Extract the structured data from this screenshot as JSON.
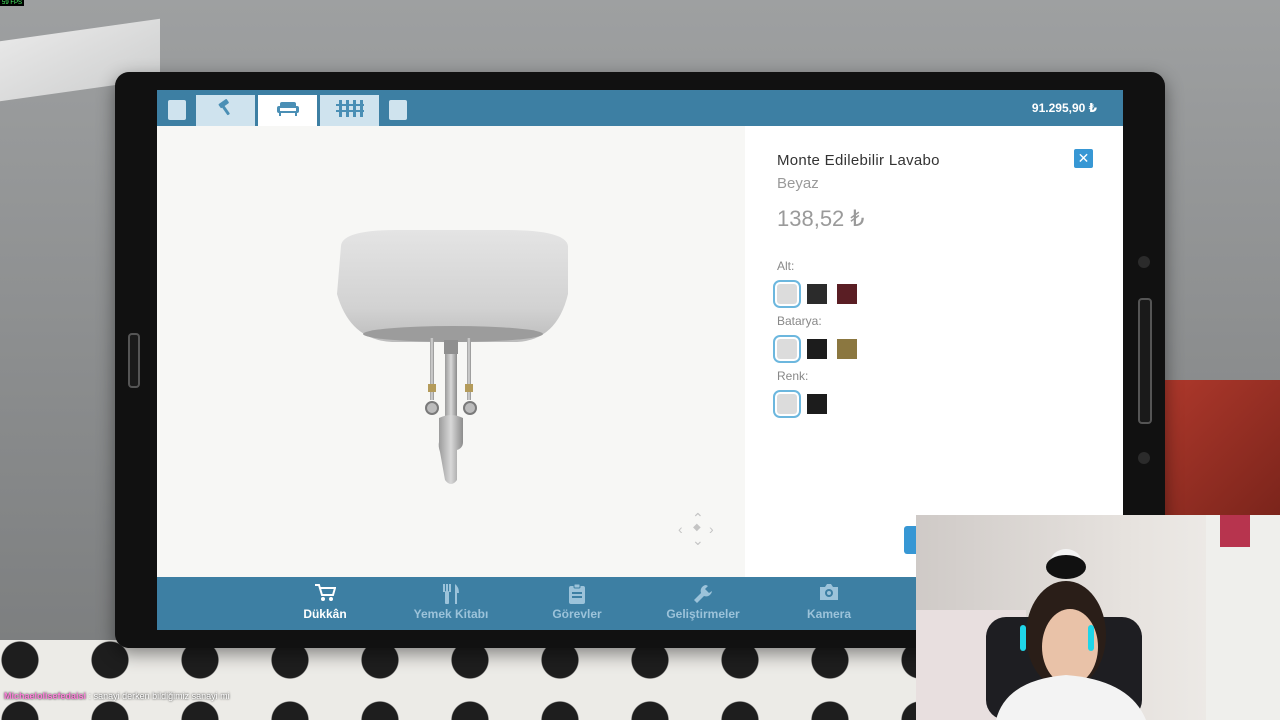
{
  "hud": {
    "fps": "59 FPS"
  },
  "topbar": {
    "tabs": [
      {
        "icon": "hammer-icon",
        "active": false
      },
      {
        "icon": "sofa-icon",
        "active": true
      },
      {
        "icon": "fence-icon",
        "active": false
      }
    ],
    "balance": "91.295,90 ₺"
  },
  "product": {
    "title": "Monte Edilebilir Lavabo",
    "subtitle": "Beyaz",
    "price": "138,52 ₺",
    "options": [
      {
        "label": "Alt:",
        "swatches": [
          "#dcdcdc",
          "#2b2b2b",
          "#5a1e24"
        ],
        "selected": 0
      },
      {
        "label": "Batarya:",
        "swatches": [
          "#dcdcdc",
          "#1c1c1c",
          "#8b7740"
        ],
        "selected": 0
      },
      {
        "label": "Renk:",
        "swatches": [
          "#dcdcdc",
          "#1c1c1c"
        ],
        "selected": 0
      }
    ]
  },
  "bottomnav": {
    "items": [
      {
        "label": "Dükkân",
        "icon": "cart-icon",
        "active": true
      },
      {
        "label": "Yemek Kitabı",
        "icon": "cutlery-icon",
        "active": false
      },
      {
        "label": "Görevler",
        "icon": "clipboard-icon",
        "active": false
      },
      {
        "label": "Geliştirmeler",
        "icon": "wrench-icon",
        "active": false
      },
      {
        "label": "Kamera",
        "icon": "camera-icon",
        "active": false
      }
    ]
  },
  "chat": {
    "user": "Michaelolisefedaisi",
    "message": ": sanayi derken bildiğimiz sanayi mi"
  },
  "colors": {
    "bar": "#3d7fa3",
    "accent": "#3797d4",
    "tab_bg": "#cfe3ee"
  }
}
